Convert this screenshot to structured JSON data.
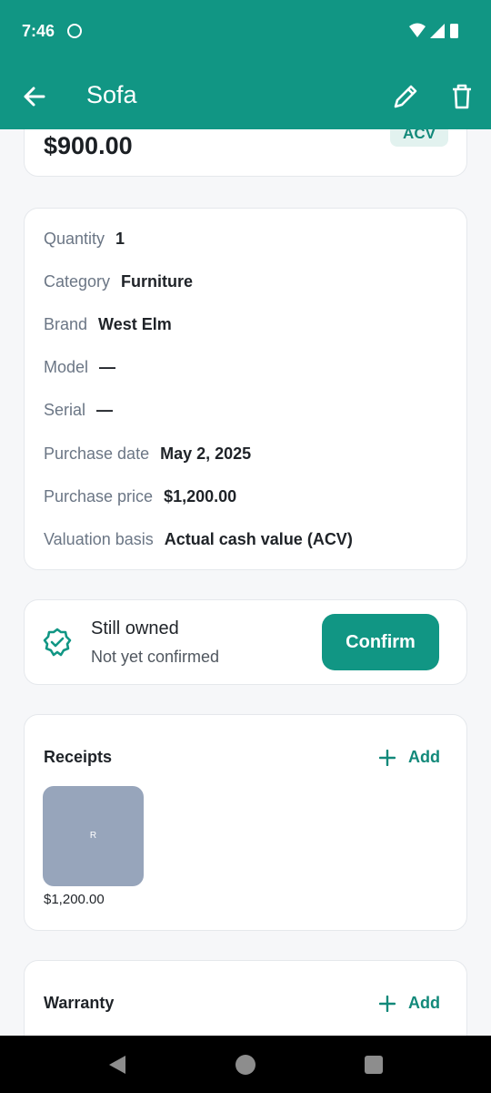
{
  "status_bar": {
    "time": "7:46",
    "icons": [
      "sync-icon",
      "wifi-icon",
      "signal-icon",
      "battery-icon"
    ]
  },
  "app_bar": {
    "title": "Sofa",
    "icons": [
      "back-arrow-icon",
      "edit-pencil-icon",
      "delete-trash-icon"
    ],
    "color": "#119684"
  },
  "value_card": {
    "amount": "$900.00",
    "badge": "ACV"
  },
  "details": [
    {
      "label": "Quantity",
      "value": "1"
    },
    {
      "label": "Category",
      "value": "Furniture"
    },
    {
      "label": "Brand",
      "value": "West Elm"
    },
    {
      "label": "Model",
      "value": "—"
    },
    {
      "label": "Serial",
      "value": "—"
    },
    {
      "label": "Purchase date",
      "value": "May 2, 2025"
    },
    {
      "label": "Purchase price",
      "value": "$1,200.00"
    },
    {
      "label": "Valuation basis",
      "value": "Actual cash value (ACV)"
    }
  ],
  "ownership": {
    "title": "Still owned",
    "subtitle": "Not yet confirmed",
    "button": "Confirm",
    "icon": "verified-badge-icon"
  },
  "receipts": {
    "title": "Receipts",
    "add_label": "Add",
    "items": [
      {
        "thumb_letter": "R",
        "amount": "$1,200.00"
      }
    ]
  },
  "warranty": {
    "title": "Warranty",
    "add_label": "Add"
  },
  "nav_bar": {
    "icons": [
      "nav-back-icon",
      "nav-home-icon",
      "nav-recents-icon"
    ]
  },
  "colors": {
    "primary": "#119684",
    "badge_bg": "#e2f2ef",
    "background": "#f6f7f9",
    "thumb": "#97a5bb"
  }
}
